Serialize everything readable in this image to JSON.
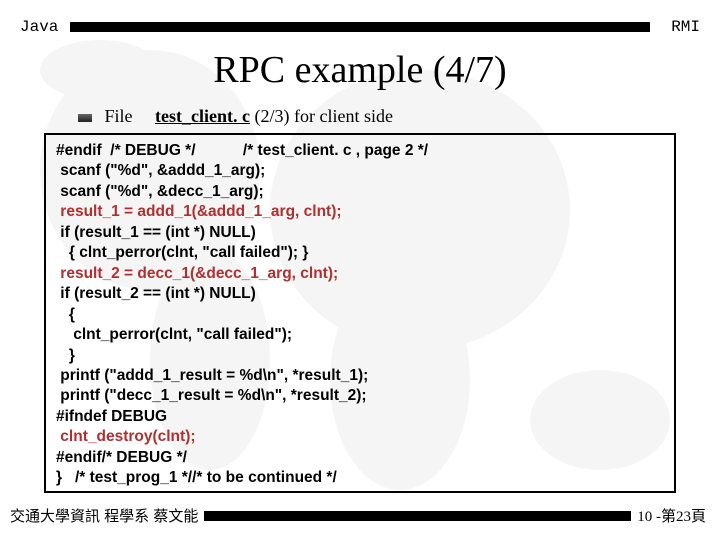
{
  "header": {
    "left": "Java",
    "right": "RMI"
  },
  "title": "RPC example  (4/7)",
  "file": {
    "label": "File",
    "name": "test_client. c",
    "desc": " (2/3) for client side"
  },
  "code": {
    "l1a": "#endif  /* DEBUG */           /* test_client. c , page 2 */",
    "l2": " scanf (\"%d\", &addd_1_arg);",
    "l3": " scanf (\"%d\", &decc_1_arg);",
    "l4": " result_1 = addd_1(&addd_1_arg, clnt);",
    "l5": " if (result_1 == (int *) NULL)",
    "l6": "   { clnt_perror(clnt, \"call failed\"); }",
    "l7": " result_2 = decc_1(&decc_1_arg, clnt);",
    "l8": " if (result_2 == (int *) NULL)",
    "l9": "   {",
    "l10": "    clnt_perror(clnt, \"call failed\");",
    "l11": "   }",
    "l12": " printf (\"addd_1_result = %d\\n\", *result_1);",
    "l13": " printf (\"decc_1_result = %d\\n\", *result_2);",
    "l14": "#ifndef DEBUG",
    "l15": " clnt_destroy(clnt);",
    "l16": "#endif/* DEBUG */",
    "l17": "}   /* test_prog_1 *//* to be continued */"
  },
  "footer": {
    "left": "交通大學資訊 程學系 蔡文能",
    "right": "10 -第23頁"
  }
}
